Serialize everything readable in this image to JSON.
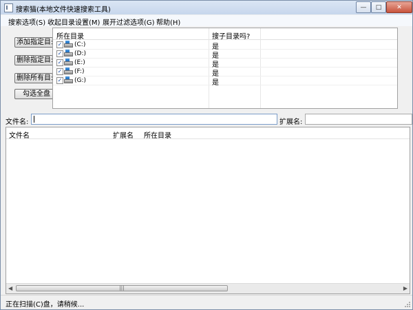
{
  "window": {
    "title": "搜索猫(本地文件快速搜索工具)"
  },
  "menu": [
    "搜索选项(S)",
    "收起目录设置(M)",
    "展开过滤选项(G)",
    "帮助(H)"
  ],
  "buttons": {
    "add_dir": "添加指定目录",
    "delete_dir": "删除指定目录",
    "delete_all": "删除所有目录",
    "select_all": "勾选全盘"
  },
  "dir_table": {
    "columns": [
      "所在目录",
      "搜子目录吗?"
    ],
    "rows": [
      {
        "label": "(C:)",
        "value": "是",
        "checked": true
      },
      {
        "label": "(D:)",
        "value": "是",
        "checked": true
      },
      {
        "label": "(E:)",
        "value": "是",
        "checked": true
      },
      {
        "label": "(F:)",
        "value": "是",
        "checked": true
      },
      {
        "label": "(G:)",
        "value": "是",
        "checked": true
      }
    ]
  },
  "filter": {
    "filename_label": "文件名:",
    "filename_value": "",
    "ext_label": "扩展名:",
    "ext_value": ""
  },
  "results": {
    "columns": [
      "文件名",
      "扩展名",
      "所在目录"
    ]
  },
  "status": "正在扫描(C)盘，请稍候..."
}
